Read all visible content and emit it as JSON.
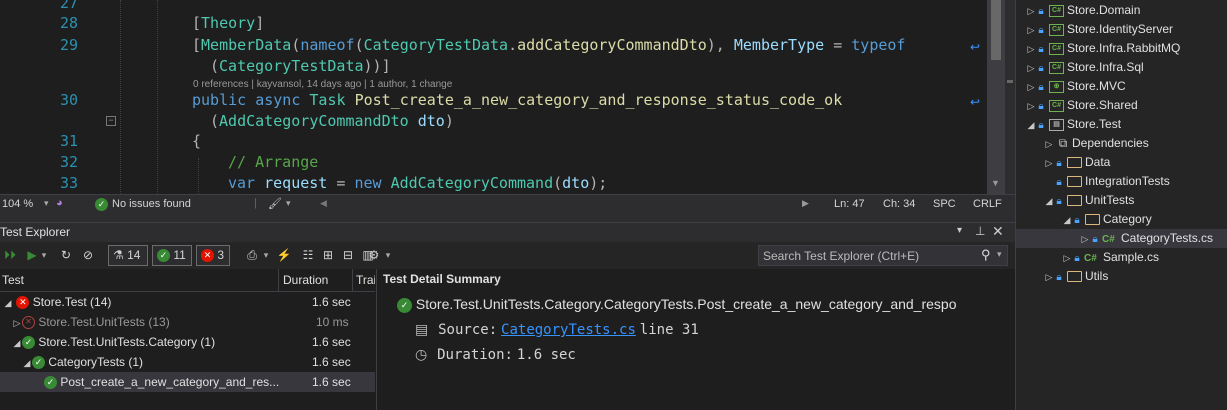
{
  "editor": {
    "lines": [
      {
        "num": "27"
      },
      {
        "num": "28"
      },
      {
        "num": "29"
      },
      {
        "num": "30"
      },
      {
        "num": "31"
      },
      {
        "num": "32"
      },
      {
        "num": "33"
      }
    ],
    "codelens": "0 references | kayvansol, 14 days ago | 1 author, 1 change",
    "tokens": {
      "attr_open": "[",
      "theory": "Theory",
      "attr_close": "]",
      "memberdata": "MemberData",
      "nameof": "nameof",
      "ctd": "CategoryTestData",
      "method_ref": "addCategoryCommandDto",
      "membertype": "MemberType",
      "typeof": "typeof",
      "ctd2": "CategoryTestData",
      "public": "public",
      "async": "async",
      "task": "Task",
      "method_name": "Post_create_a_new_category_and_response_status_code_ok",
      "param_type": "AddCategoryCommandDto",
      "param_name": "dto",
      "brace": "{",
      "comment": "// Arrange",
      "var": "var",
      "request": "request",
      "new": "new",
      "cmd": "AddCategoryCommand",
      "arg": "dto"
    }
  },
  "statusbar": {
    "zoom": "104 %",
    "issues": "No issues found",
    "ln": "Ln: 47",
    "ch": "Ch: 34",
    "spc": "SPC",
    "crlf": "CRLF"
  },
  "solution_explorer": {
    "items": [
      {
        "label": "Store.Domain"
      },
      {
        "label": "Store.IdentityServer"
      },
      {
        "label": "Store.Infra.RabbitMQ"
      },
      {
        "label": "Store.Infra.Sql"
      },
      {
        "label": "Store.MVC"
      },
      {
        "label": "Store.Shared"
      },
      {
        "label": "Store.Test"
      },
      {
        "label": "Dependencies"
      },
      {
        "label": "Data"
      },
      {
        "label": "IntegrationTests"
      },
      {
        "label": "UnitTests"
      },
      {
        "label": "Category"
      },
      {
        "label": "CategoryTests.cs"
      },
      {
        "label": "Sample.cs"
      },
      {
        "label": "Utils"
      }
    ]
  },
  "test_explorer": {
    "title": "Test Explorer",
    "total": "14",
    "passed": "11",
    "failed": "3",
    "search_placeholder": "Search Test Explorer (Ctrl+E)",
    "columns": {
      "test": "Test",
      "duration": "Duration",
      "traits": "Trai"
    },
    "rows": [
      {
        "name": "Store.Test (14)",
        "duration": "1.6 sec",
        "status": "fail"
      },
      {
        "name": "Store.Test.UnitTests (13)",
        "duration": "10 ms",
        "status": "fail"
      },
      {
        "name": "Store.Test.UnitTests.Category (1)",
        "duration": "1.6 sec",
        "status": "pass"
      },
      {
        "name": "CategoryTests (1)",
        "duration": "1.6 sec",
        "status": "pass"
      },
      {
        "name": "Post_create_a_new_category_and_res...",
        "duration": "1.6 sec",
        "status": "pass"
      }
    ],
    "detail": {
      "heading": "Test Detail Summary",
      "test_name": "Store.Test.UnitTests.Category.CategoryTests.Post_create_a_new_category_and_respo",
      "source_label": "Source:",
      "source_link": "CategoryTests.cs",
      "source_line": "line 31",
      "duration_label": "Duration:",
      "duration_value": "1.6 sec"
    }
  },
  "colors": {
    "accent_blue": "#007acc",
    "pass_green": "#388a34",
    "fail_red": "#e51400"
  }
}
